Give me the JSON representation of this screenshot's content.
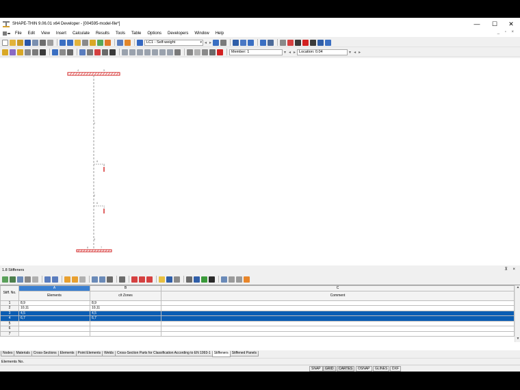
{
  "window": {
    "title": "SHAPE-THIN 9.06.01 x64 Developer - [004595-model-file*]",
    "minimize": "—",
    "maximize": "☐",
    "close": "✕"
  },
  "menubar": {
    "items": [
      "File",
      "Edit",
      "View",
      "Insert",
      "Calculate",
      "Results",
      "Tools",
      "Table",
      "Options",
      "Developers",
      "Window",
      "Help"
    ],
    "mdi_controls": "_ ▫ ×"
  },
  "toolbar1": {
    "load_case": "LC1 - Self-weight"
  },
  "toolbar2": {
    "member_label": "Member: 1",
    "location_label": "Location: 0.04"
  },
  "canvas": {
    "node_labels": [
      "4",
      "5",
      "1",
      "8",
      "9",
      "2",
      "6",
      "7",
      "3",
      "6",
      "7"
    ]
  },
  "panel": {
    "title": "1.8 Stiffeners",
    "controls": "⊼ ×"
  },
  "grid": {
    "column_letters": [
      "A",
      "B",
      "C"
    ],
    "corner_header": "Stiff. No.",
    "column_headers": [
      "Elements",
      "c/t Zones",
      "Comment"
    ],
    "rows": [
      {
        "no": "1",
        "elements": "8,9",
        "zones": "8,9",
        "comment": ""
      },
      {
        "no": "2",
        "elements": "10,11",
        "zones": "10,11",
        "comment": ""
      },
      {
        "no": "3",
        "elements": "4,5",
        "zones": "4,5",
        "comment": ""
      },
      {
        "no": "4",
        "elements": "6,7",
        "zones": "6,7",
        "comment": ""
      },
      {
        "no": "5",
        "elements": "",
        "zones": "",
        "comment": ""
      },
      {
        "no": "6",
        "elements": "",
        "zones": "",
        "comment": ""
      },
      {
        "no": "7",
        "elements": "",
        "zones": "",
        "comment": ""
      }
    ],
    "selected_rows": [
      "3",
      "4"
    ]
  },
  "tabs": [
    "Nodes",
    "Materials",
    "Cross-Sections",
    "Elements",
    "Point Elements",
    "Welds",
    "Cross-Section Parts for Classification According to EN 1993-1",
    "Stiffeners",
    "Stiffened Panels"
  ],
  "active_tab": "Stiffeners",
  "status_line": "Elements No.",
  "status_buttons": [
    "SNAP",
    "GRID",
    "CARTES",
    "OSNAP",
    "GLINES",
    "DXF"
  ],
  "colors": {
    "selection": "#0b5db3",
    "member_red": "#d21f1f",
    "node_gray": "#9a9a9a"
  }
}
